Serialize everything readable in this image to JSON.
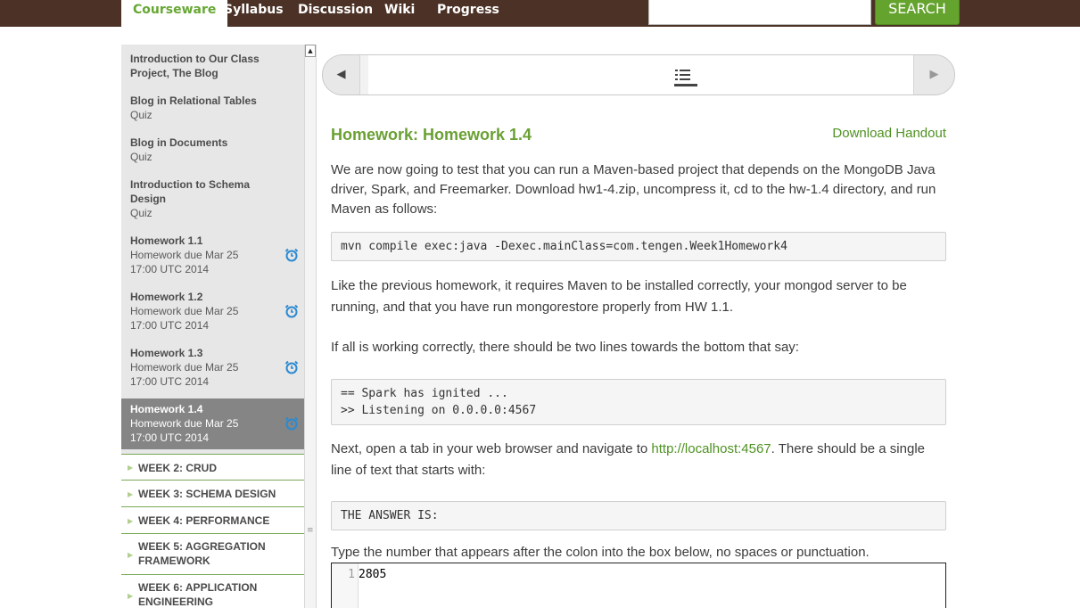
{
  "nav": {
    "items": [
      "Courseware",
      "Syllabus",
      "Discussion",
      "Wiki",
      "Progress"
    ],
    "search_button": "SEARCH",
    "search_value": ""
  },
  "sidebar": {
    "lessons": [
      {
        "title": "Introduction to Our Class Project, The Blog",
        "sub": ""
      },
      {
        "title": "Blog in Relational Tables",
        "sub": "Quiz"
      },
      {
        "title": "Blog in Documents",
        "sub": "Quiz"
      },
      {
        "title": "Introduction to Schema Design",
        "sub": "Quiz"
      },
      {
        "title": "Homework 1.1",
        "sub": "Homework due Mar 25 17:00 UTC 2014"
      },
      {
        "title": "Homework 1.2",
        "sub": "Homework due Mar 25 17:00 UTC 2014"
      },
      {
        "title": "Homework 1.3",
        "sub": "Homework due Mar 25 17:00 UTC 2014"
      },
      {
        "title": "Homework 1.4",
        "sub": "Homework due Mar 25 17:00 UTC 2014"
      }
    ],
    "weeks": [
      "WEEK 2: CRUD",
      "WEEK 3: SCHEMA DESIGN",
      "WEEK 4: PERFORMANCE",
      "WEEK 5: AGGREGATION FRAMEWORK",
      "WEEK 6: APPLICATION ENGINEERING"
    ]
  },
  "content": {
    "title": "Homework: Homework 1.4",
    "download": "Download Handout",
    "p1": "We are now going to test that you can run a Maven-based project that depends on the MongoDB Java driver, Spark, and Freemarker. Download hw1-4.zip, uncompress it, cd to the hw-1.4 directory, and run Maven as follows:",
    "code1": "mvn compile exec:java -Dexec.mainClass=com.tengen.Week1Homework4",
    "p2": "Like the previous homework, it requires Maven to be installed correctly, your mongod server to be running, and that you have run mongorestore properly from HW 1.1.",
    "p3": "If all is working correctly, there should be two lines towards the bottom that say:",
    "code2": [
      "== Spark has ignited ...",
      ">> Listening on 0.0.0.0:4567"
    ],
    "p4_before": "Next, open a tab in your web browser and navigate to ",
    "p4_link": "http://localhost:4567",
    "p4_after": ". There should be a single line of text that starts with:",
    "code3": "THE ANSWER IS:",
    "p5": "Type the number that appears after the colon into the box below, no spaces or punctuation.",
    "editor": {
      "line_number": "1",
      "value": "2805"
    }
  },
  "colors": {
    "topbar": "#4c3226",
    "accent_green": "#6aa033",
    "active_lesson": "#858585",
    "alarm_icon": "#2a8ad2"
  }
}
